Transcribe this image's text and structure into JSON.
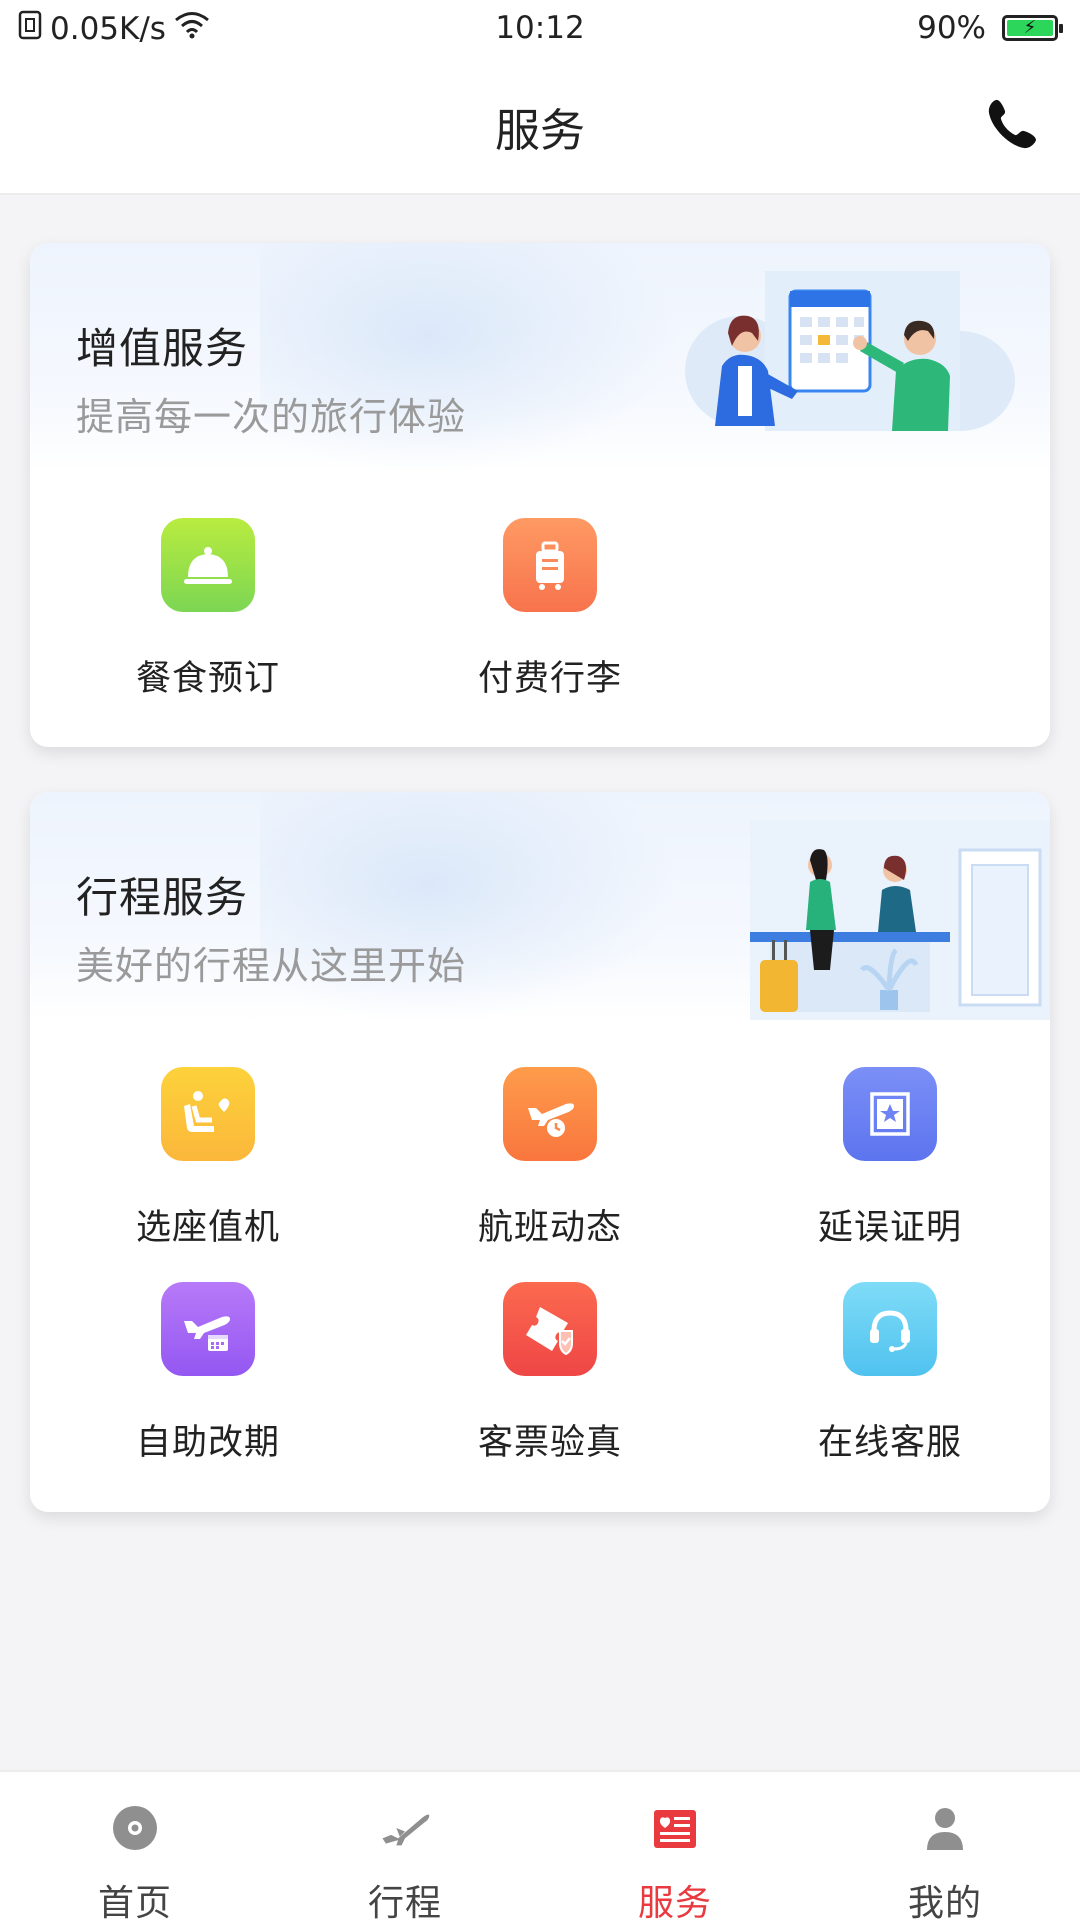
{
  "status_bar": {
    "speed": "0.05K/s",
    "time": "10:12",
    "battery": "90%",
    "icons": [
      "sim-icon",
      "wifi-icon",
      "battery-icon"
    ]
  },
  "header": {
    "title": "服务",
    "action_icon": "phone-icon"
  },
  "value_added": {
    "title": "增值服务",
    "subtitle": "提高每一次的旅行体验",
    "items": [
      {
        "label": "餐食预订",
        "icon": "meal-icon",
        "color": "#9be04a"
      },
      {
        "label": "付费行李",
        "icon": "luggage-icon",
        "color": "#fb8a5a"
      }
    ]
  },
  "trip_services": {
    "title": "行程服务",
    "subtitle": "美好的行程从这里开始",
    "items": [
      {
        "label": "选座值机",
        "icon": "seat-checkin-icon",
        "color": "#fbc83a"
      },
      {
        "label": "航班动态",
        "icon": "flight-status-icon",
        "color": "#fd8c45"
      },
      {
        "label": "延误证明",
        "icon": "delay-certificate-icon",
        "color": "#6f84f4"
      },
      {
        "label": "自助改期",
        "icon": "reschedule-icon",
        "color": "#a96bf6"
      },
      {
        "label": "客票验真",
        "icon": "ticket-verify-icon",
        "color": "#f45a4a"
      },
      {
        "label": "在线客服",
        "icon": "online-support-icon",
        "color": "#62cdf3"
      }
    ]
  },
  "bottom_nav": {
    "active_color": "#e83a3f",
    "items": [
      {
        "label": "首页",
        "icon": "home-icon"
      },
      {
        "label": "行程",
        "icon": "plane-icon"
      },
      {
        "label": "服务",
        "icon": "service-icon"
      },
      {
        "label": "我的",
        "icon": "profile-icon"
      }
    ]
  }
}
